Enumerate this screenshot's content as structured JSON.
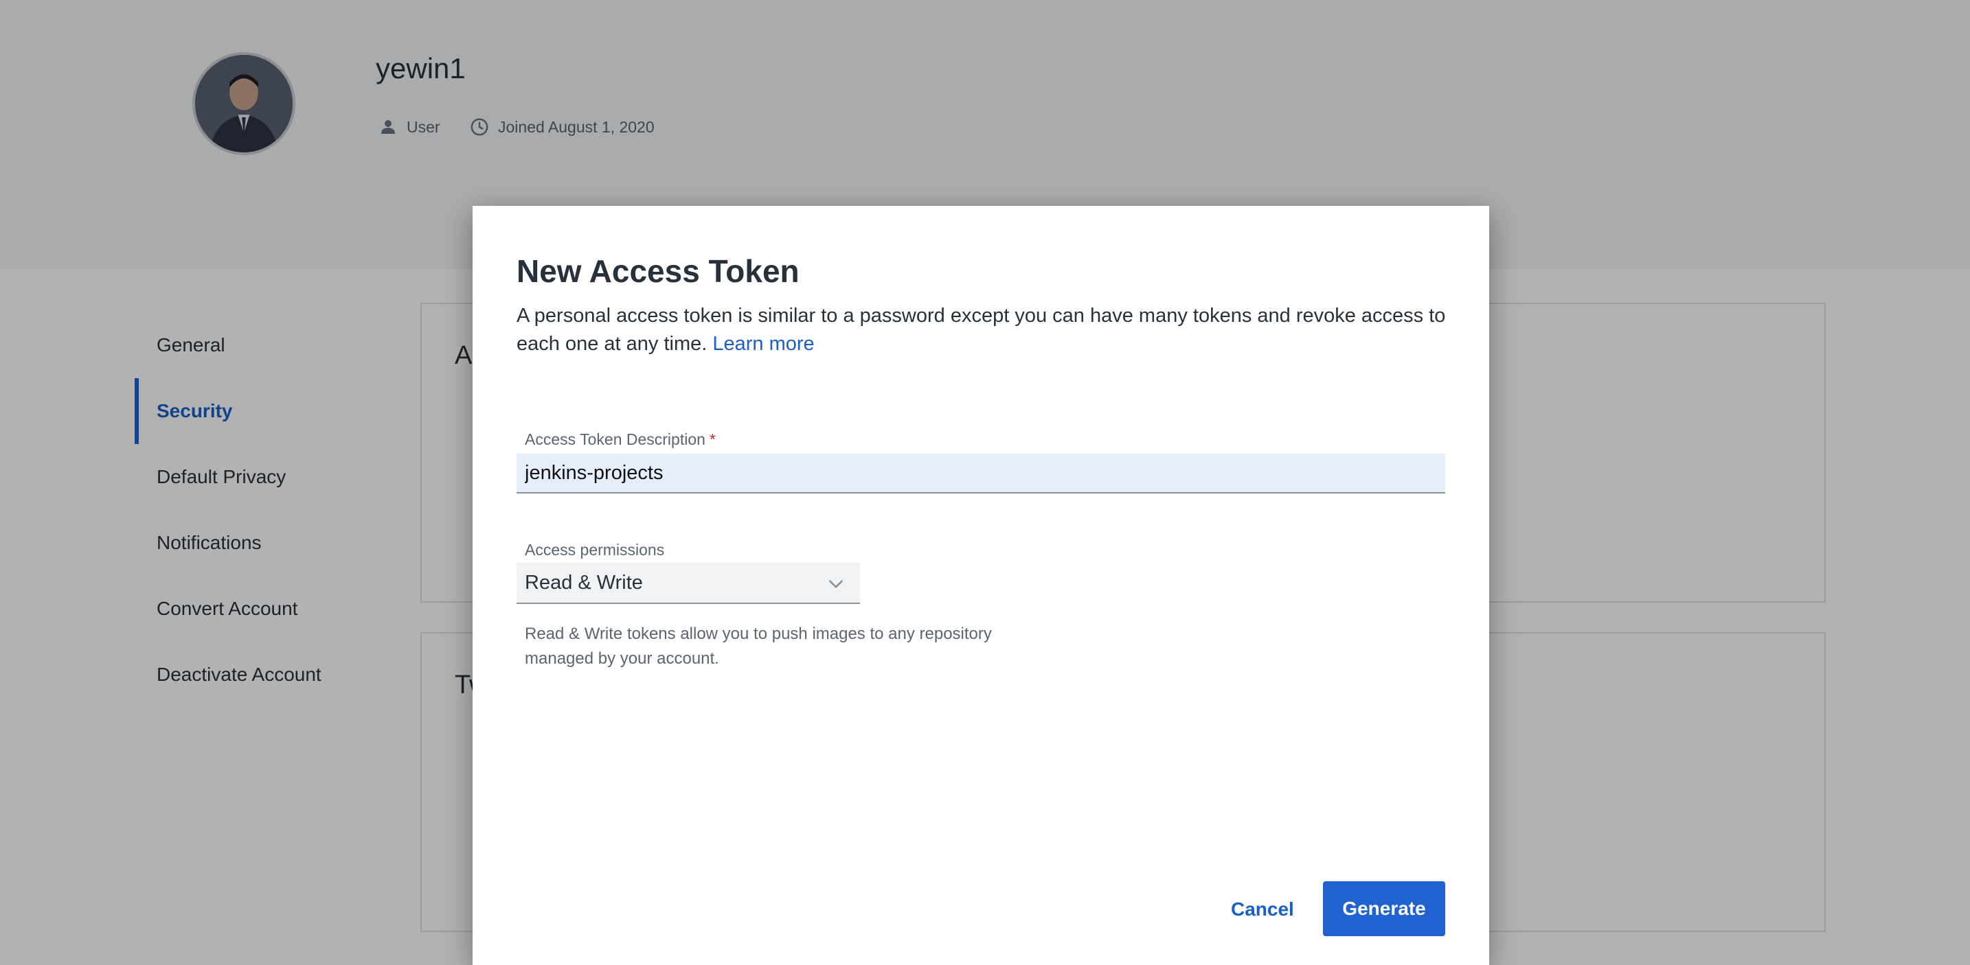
{
  "profile": {
    "username": "yewin1",
    "role": "User",
    "joined": "Joined August 1, 2020"
  },
  "sidebar": {
    "items": [
      {
        "label": "General"
      },
      {
        "label": "Security"
      },
      {
        "label": "Default Privacy"
      },
      {
        "label": "Notifications"
      },
      {
        "label": "Convert Account"
      },
      {
        "label": "Deactivate Account"
      }
    ],
    "active": "Security"
  },
  "cards": [
    {
      "title_fragment": "A"
    },
    {
      "title_fragment": "Tw"
    }
  ],
  "modal": {
    "title": "New Access Token",
    "description": "A personal access token is similar to a password except you can have many tokens and revoke access to each one at any time.",
    "learn_more": "Learn more",
    "description_field": {
      "label": "Access Token Description",
      "required_mark": "*",
      "value": "jenkins-projects"
    },
    "permissions": {
      "label": "Access permissions",
      "selected": "Read & Write",
      "helper": "Read & Write tokens allow you to push images to any repository managed by your account."
    },
    "buttons": {
      "cancel": "Cancel",
      "generate": "Generate"
    }
  },
  "colors": {
    "accent": "#1f63d1",
    "link": "#1a5fc8",
    "required": "#d22b2b",
    "input_bg": "#e7eefb"
  },
  "icons": {
    "role": "person-icon",
    "joined": "clock-icon",
    "select": "chevron-down-icon"
  }
}
